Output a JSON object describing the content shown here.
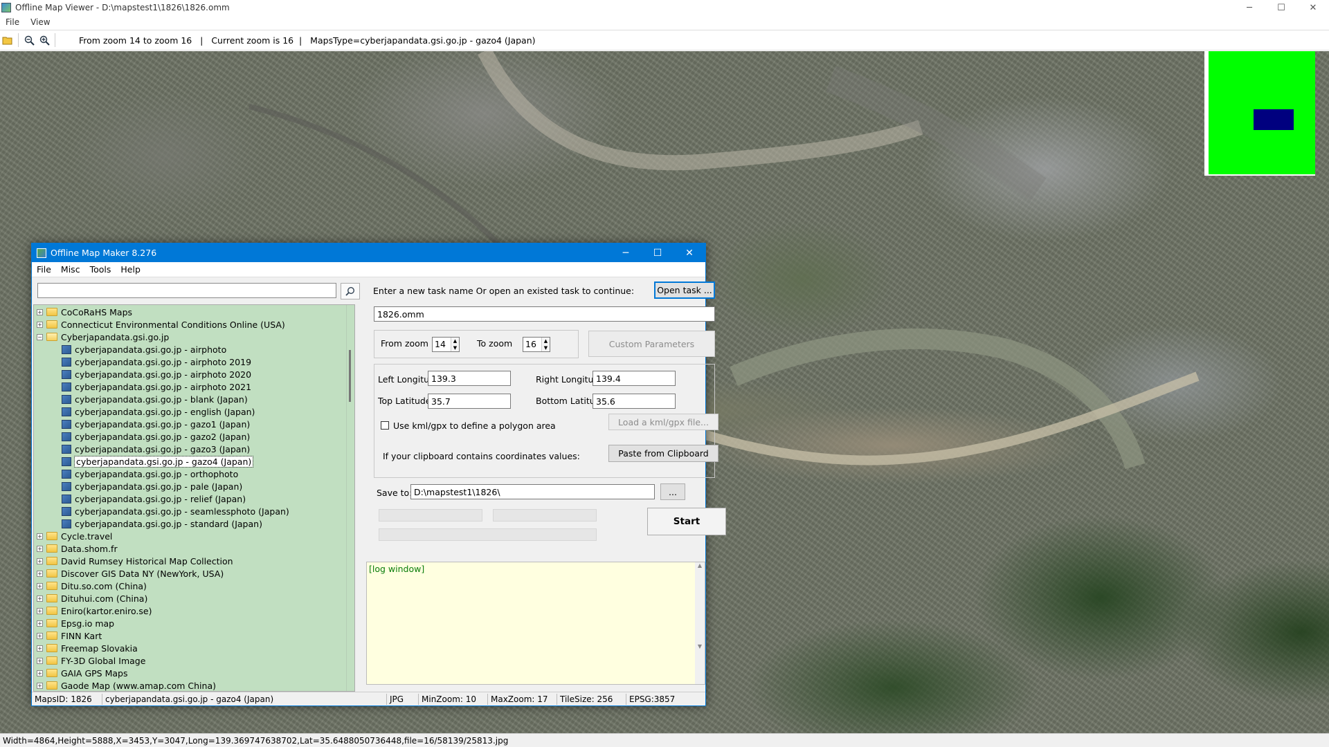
{
  "window": {
    "title": "Offline Map Viewer - D:\\mapstest1\\1826\\1826.omm",
    "controls": {
      "minimize": "─",
      "maximize": "☐",
      "close": "✕"
    }
  },
  "menu": {
    "file": "File",
    "view": "View"
  },
  "toolbar": {
    "open_icon": "folder-open-icon",
    "zoom_out_icon": "zoom-out-icon",
    "zoom_in_icon": "zoom-in-icon",
    "status": "From zoom 14 to zoom 16   |   Current zoom is 16  |   MapsType=cyberjapandata.gsi.go.jp - gazo4 (Japan)"
  },
  "minimap": {
    "background_color": "#00ff00",
    "viewport_color": "#00007f"
  },
  "statusbar": {
    "text": "Width=4864,Height=5888,X=3453,Y=3047,Long=139.369747638702,Lat=35.6488050736448,file=16/58139/25813.jpg"
  },
  "dialog": {
    "title": "Offline Map Maker 8.276",
    "controls": {
      "minimize": "─",
      "maximize": "☐",
      "close": "✕"
    },
    "menu": {
      "file": "File",
      "misc": "Misc",
      "tools": "Tools",
      "help": "Help"
    },
    "search": {
      "value": "",
      "icon": "search-icon"
    },
    "tree": {
      "top": [
        "CoCoRaHS Maps",
        "Connecticut Environmental Conditions Online (USA)"
      ],
      "open_folder": "Cyberjapandata.gsi.go.jp",
      "children": [
        "cyberjapandata.gsi.go.jp - airphoto",
        "cyberjapandata.gsi.go.jp - airphoto 2019",
        "cyberjapandata.gsi.go.jp - airphoto 2020",
        "cyberjapandata.gsi.go.jp - airphoto 2021",
        "cyberjapandata.gsi.go.jp - blank (Japan)",
        "cyberjapandata.gsi.go.jp - english (Japan)",
        "cyberjapandata.gsi.go.jp - gazo1 (Japan)",
        "cyberjapandata.gsi.go.jp - gazo2 (Japan)",
        "cyberjapandata.gsi.go.jp - gazo3 (Japan)",
        "cyberjapandata.gsi.go.jp - gazo4 (Japan)",
        "cyberjapandata.gsi.go.jp - orthophoto",
        "cyberjapandata.gsi.go.jp - pale (Japan)",
        "cyberjapandata.gsi.go.jp - relief (Japan)",
        "cyberjapandata.gsi.go.jp - seamlessphoto (Japan)",
        "cyberjapandata.gsi.go.jp - standard (Japan)"
      ],
      "selected_child": "cyberjapandata.gsi.go.jp - gazo4 (Japan)",
      "bottom": [
        "Cycle.travel",
        "Data.shom.fr",
        "David Rumsey Historical Map Collection",
        "Discover GIS Data NY (NewYork, USA)",
        "Ditu.so.com (China)",
        "Dituhui.com (China)",
        "Eniro(kartor.eniro.se)",
        "Epsg.io map",
        "FINN Kart",
        "Freemap Slovakia",
        "FY-3D Global Image",
        "GAIA GPS Maps",
        "Gaode Map (www.amap.com China)"
      ]
    },
    "task": {
      "prompt": "Enter a new task name Or open an existed task to continue:",
      "open_button": "Open task ...",
      "name_value": "1826.omm"
    },
    "zoom": {
      "from_label": "From zoom",
      "from_value": "14",
      "to_label": "To zoom",
      "to_value": "16",
      "custom_button": "Custom Parameters"
    },
    "coords": {
      "left_lon_label": "Left Longitude",
      "left_lon": "139.3",
      "right_lon_label": "Right Longitude",
      "right_lon": "139.4",
      "top_lat_label": "Top Latitude",
      "top_lat": "35.7",
      "bottom_lat_label": "Bottom Latitude",
      "bottom_lat": "35.6",
      "kml_checkbox_label": "Use kml/gpx to define a polygon area",
      "kml_checked": false,
      "kml_button": "Load a kml/gpx file...",
      "clipboard_label": "If your clipboard contains coordinates values:",
      "clipboard_button": "Paste from Clipboard"
    },
    "save": {
      "label": "Save to:",
      "path": "D:\\mapstest1\\1826\\",
      "browse_button": "..."
    },
    "start_button": "Start",
    "log_window": "[log window]",
    "status": {
      "maps_id": "MapsID: 1826",
      "maps_name": "cyberjapandata.gsi.go.jp - gazo4 (Japan)",
      "format": "JPG",
      "min_zoom": "MinZoom: 10",
      "max_zoom": "MaxZoom: 17",
      "tile_size": "TileSize: 256",
      "epsg": "EPSG:3857"
    }
  }
}
